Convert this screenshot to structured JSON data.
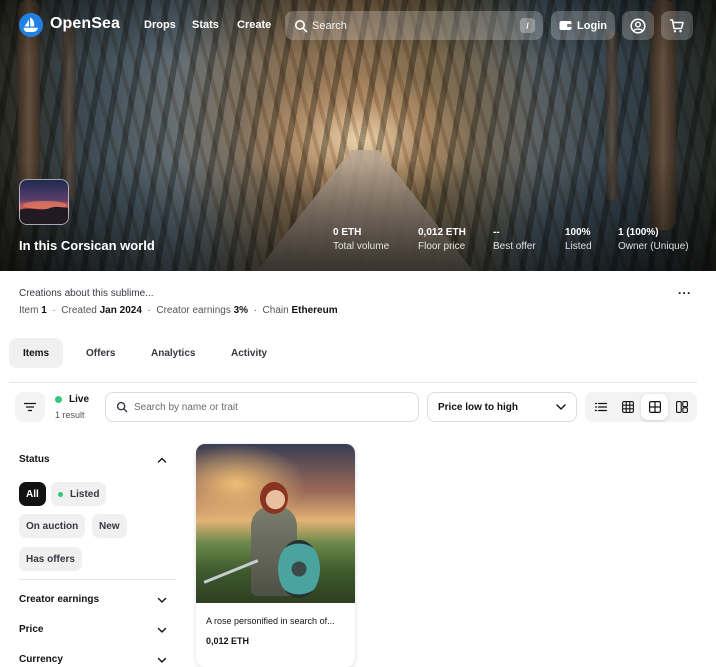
{
  "nav": {
    "brand": "OpenSea",
    "links": [
      "Drops",
      "Stats",
      "Create"
    ],
    "search_placeholder": "Search",
    "search_shortcut": "/",
    "login_label": "Login"
  },
  "collection": {
    "title": "In this Corsican world",
    "stats": [
      {
        "value": "0 ETH",
        "label": "Total volume"
      },
      {
        "value": "0,012 ETH",
        "label": "Floor price"
      },
      {
        "value": "--",
        "label": "Best offer"
      },
      {
        "value": "100%",
        "label": "Listed"
      },
      {
        "value": "1 (100%)",
        "label": "Owner (Unique)"
      }
    ],
    "description": "Creations about this sublime...",
    "meta": {
      "items_label": "Item",
      "items_value": "1",
      "created_label": "Created",
      "created_value": "Jan 2024",
      "earnings_label": "Creator earnings",
      "earnings_value": "3%",
      "chain_label": "Chain",
      "chain_value": "Ethereum",
      "separator": "·"
    },
    "more_label": "···"
  },
  "tabs": [
    "Items",
    "Offers",
    "Analytics",
    "Activity"
  ],
  "toolbar": {
    "live_label": "Live",
    "result_count": "1 result",
    "search_placeholder": "Search by name or trait",
    "sort_label": "Price low to high"
  },
  "sidebar": {
    "status_title": "Status",
    "chips": [
      "All",
      "Listed",
      "On auction",
      "New",
      "Has offers"
    ],
    "sections": [
      "Creator earnings",
      "Price",
      "Currency"
    ]
  },
  "items": [
    {
      "name": "A rose personified in search of...",
      "price": "0,012 ETH"
    }
  ],
  "colors": {
    "accent": "#2081e2",
    "live": "#34c77b",
    "text": "#121212"
  }
}
